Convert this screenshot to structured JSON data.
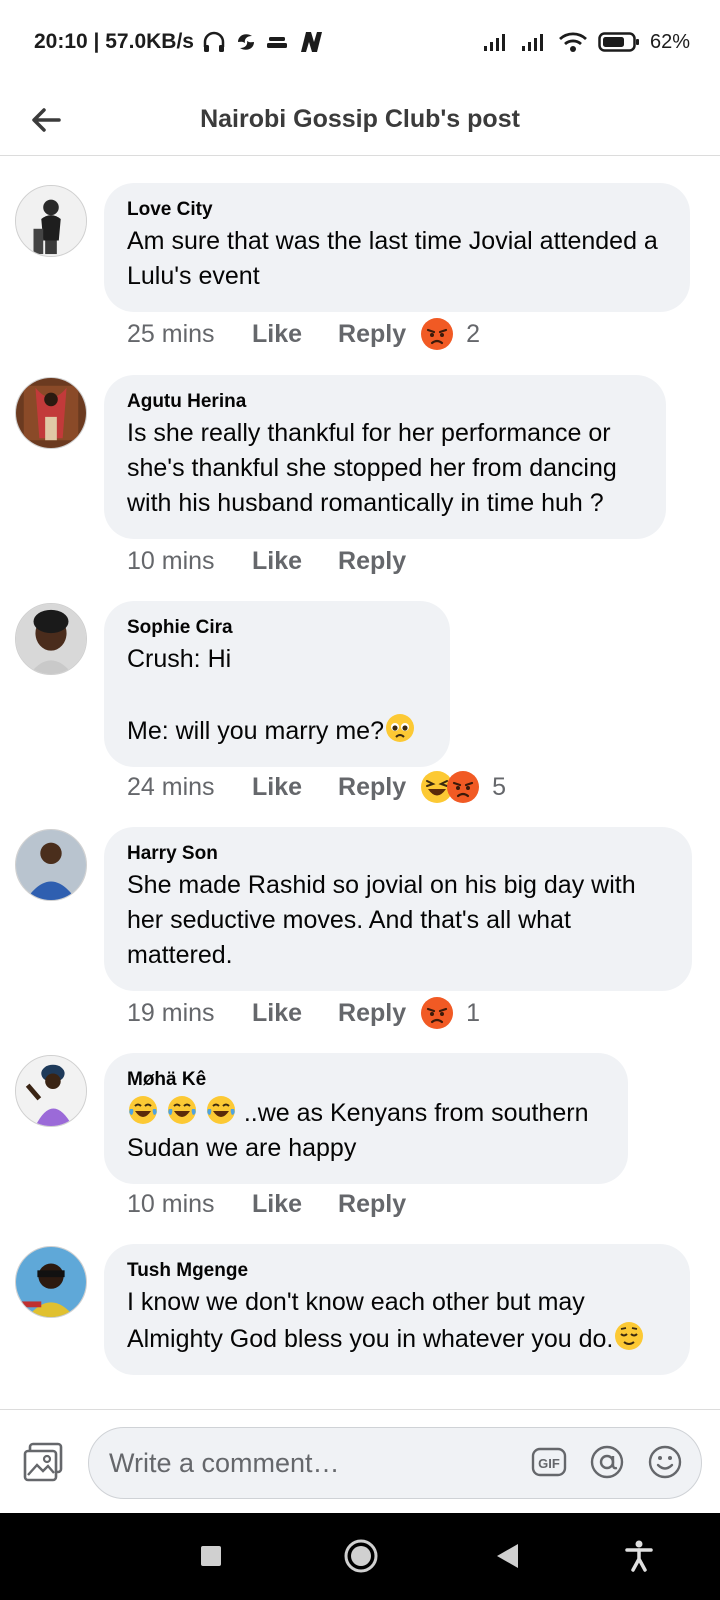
{
  "status_bar": {
    "time_speed": "20:10 | 57.0KB/s",
    "battery_pct": "62%"
  },
  "header": {
    "title": "Nairobi Gossip Club's post",
    "back_icon": "arrow-left-icon"
  },
  "comments": [
    {
      "name": "Love City",
      "text": "Am sure that was the last time Jovial attended a Lulu's event",
      "time": "25 mins",
      "like": "Like",
      "reply": "Reply",
      "reactions": [
        "angry"
      ],
      "reaction_count": "2"
    },
    {
      "name": "Agutu Herina",
      "text": "Is she really thankful for her performance or she's thankful she stopped her from dancing with his husband romantically in time huh ?",
      "time": "10 mins",
      "like": "Like",
      "reply": "Reply",
      "reactions": [],
      "reaction_count": ""
    },
    {
      "name": "Sophie Cira",
      "text": "Crush: Hi\n\nMe: will you marry me?",
      "text_emoji": "pleading-face",
      "time": "24 mins",
      "like": "Like",
      "reply": "Reply",
      "reactions": [
        "haha",
        "angry"
      ],
      "reaction_count": "5"
    },
    {
      "name": "Harry Son",
      "text": "She made Rashid so jovial on his big day with her seductive moves. And that's all what mattered.",
      "time": "19 mins",
      "like": "Like",
      "reply": "Reply",
      "reactions": [
        "angry"
      ],
      "reaction_count": "1"
    },
    {
      "name": "Møhä Kê",
      "text_lead_emoji": [
        "tears-of-joy",
        "tears-of-joy",
        "tears-of-joy"
      ],
      "text": " ..we as Kenyans from southern Sudan we are happy",
      "time": "10 mins",
      "like": "Like",
      "reply": "Reply",
      "reactions": [],
      "reaction_count": ""
    },
    {
      "name": "Tush Mgenge",
      "text": "I know we don't know each other but may Almighty God bless you in whatever you do.",
      "text_emoji": "relieved-face",
      "time": "",
      "like": "",
      "reply": "",
      "reactions": [],
      "reaction_count": ""
    }
  ],
  "composer": {
    "placeholder": "Write a comment…",
    "gif_label": "GIF"
  },
  "colors": {
    "bubble": "#f0f2f5",
    "secondary_text": "#65676b",
    "angry": "#f15a24",
    "haha": "#fcc934"
  }
}
